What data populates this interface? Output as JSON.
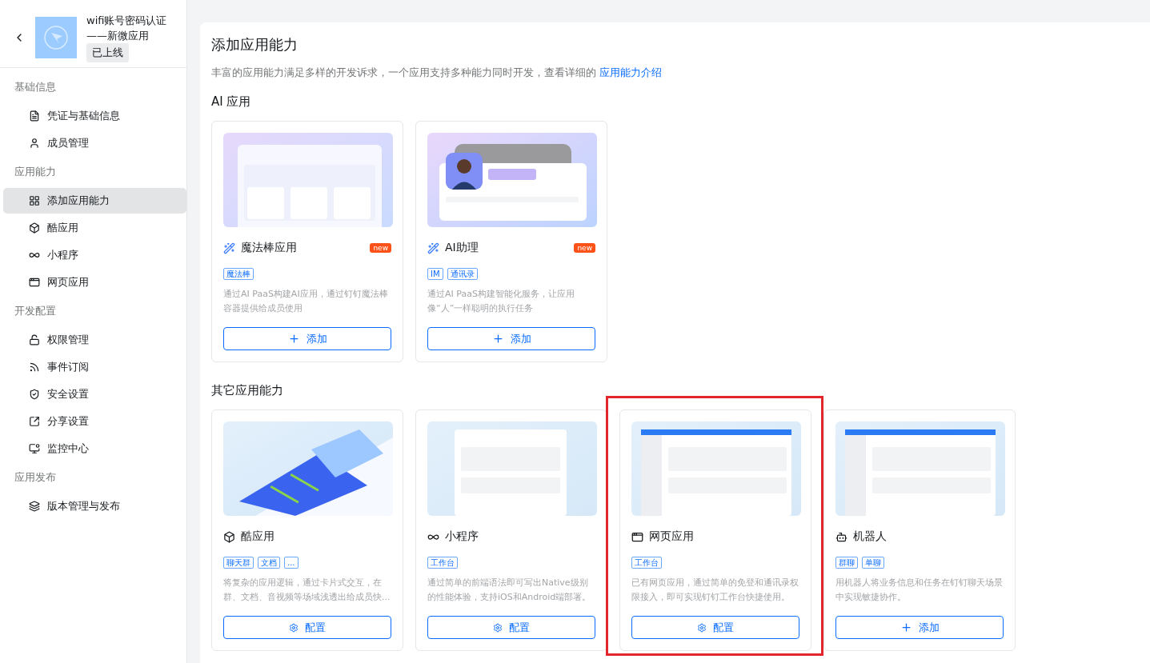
{
  "app": {
    "name": "wifi账号密码认证——新微应用",
    "status": "已上线"
  },
  "sidebar": {
    "sections": [
      {
        "title": "基础信息",
        "items": [
          {
            "label": "凭证与基础信息",
            "selected": false
          },
          {
            "label": "成员管理",
            "selected": false
          }
        ]
      },
      {
        "title": "应用能力",
        "items": [
          {
            "label": "添加应用能力",
            "selected": true
          },
          {
            "label": "酷应用",
            "selected": false
          },
          {
            "label": "小程序",
            "selected": false
          },
          {
            "label": "网页应用",
            "selected": false
          }
        ]
      },
      {
        "title": "开发配置",
        "items": [
          {
            "label": "权限管理",
            "selected": false
          },
          {
            "label": "事件订阅",
            "selected": false
          },
          {
            "label": "安全设置",
            "selected": false
          },
          {
            "label": "分享设置",
            "selected": false
          },
          {
            "label": "监控中心",
            "selected": false
          }
        ]
      },
      {
        "title": "应用发布",
        "items": [
          {
            "label": "版本管理与发布",
            "selected": false
          }
        ]
      }
    ]
  },
  "main": {
    "title": "添加应用能力",
    "intro": "丰富的应用能力满足多样的开发诉求，一个应用支持多种能力同时开发，查看详细的",
    "intro_link": "应用能力介绍",
    "sections": [
      {
        "title": "AI 应用",
        "cards": [
          {
            "title": "魔法棒应用",
            "badge": "new",
            "tags": [
              "魔法棒"
            ],
            "description": "通过AI PaaS构建AI应用，通过钉钉魔法棒容器提供给成员使用",
            "action": {
              "kind": "add",
              "label": "添加"
            },
            "highlighted": false
          },
          {
            "title": "AI助理",
            "badge": "new",
            "tags": [
              "IM",
              "通讯录"
            ],
            "description": "通过AI PaaS构建智能化服务，让应用像“人”一样聪明的执行任务",
            "action": {
              "kind": "add",
              "label": "添加"
            },
            "highlighted": false
          }
        ]
      },
      {
        "title": "其它应用能力",
        "cards": [
          {
            "title": "酷应用",
            "tags": [
              "聊天群",
              "文档",
              "..."
            ],
            "description": "将复杂的应用逻辑，通过卡片式交互，在群、文档、音视频等场域浅透出给成员快...",
            "action": {
              "kind": "configure",
              "label": "配置"
            },
            "highlighted": false
          },
          {
            "title": "小程序",
            "tags": [
              "工作台"
            ],
            "description": "通过简单的前端语法即可写出Native级别的性能体验，支持iOS和Android端部署。",
            "action": {
              "kind": "configure",
              "label": "配置"
            },
            "highlighted": false
          },
          {
            "title": "网页应用",
            "tags": [
              "工作台"
            ],
            "description": "已有网页应用，通过简单的免登和通讯录权限接入，即可实现钉钉工作台快捷使用。",
            "action": {
              "kind": "configure",
              "label": "配置"
            },
            "highlighted": true
          },
          {
            "title": "机器人",
            "tags": [
              "群聊",
              "单聊"
            ],
            "description": "用机器人将业务信息和任务在钉钉聊天场景中实现敏捷协作。",
            "action": {
              "kind": "add",
              "label": "添加"
            },
            "highlighted": false
          }
        ]
      }
    ]
  }
}
